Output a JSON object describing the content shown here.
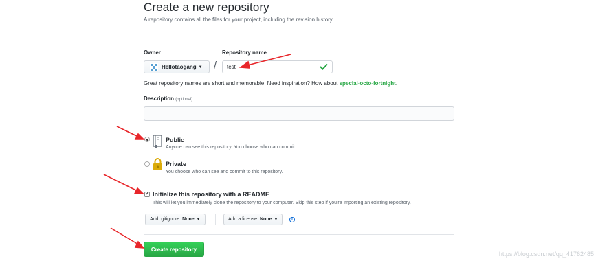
{
  "page": {
    "title": "Create a new repository",
    "subtitle": "A repository contains all the files for your project, including the revision history."
  },
  "owner": {
    "label": "Owner",
    "value": "Hellotaogang",
    "avatar_icon": "avatar-identicon",
    "avatar_color": "#57a0d3"
  },
  "separator": "/",
  "repo_name": {
    "label": "Repository name",
    "value": "test",
    "valid_icon": "check-icon",
    "valid_color": "#28a745"
  },
  "hint": {
    "text": "Great repository names are short and memorable. Need inspiration? How about",
    "suggestion": "special-octo-fortnight",
    "end": "."
  },
  "description": {
    "label": "Description",
    "optional": "(optional)",
    "value": ""
  },
  "visibility": {
    "public": {
      "title": "Public",
      "desc": "Anyone can see this repository. You choose who can commit.",
      "selected": true,
      "icon": "repo-book-icon"
    },
    "private": {
      "title": "Private",
      "desc": "You choose who can see and commit to this repository.",
      "selected": false,
      "icon": "lock-icon"
    }
  },
  "readme": {
    "title": "Initialize this repository with a README",
    "desc": "This will let you immediately clone the repository to your computer. Skip this step if you're importing an existing repository.",
    "checked": true,
    "check_mark": "✔"
  },
  "gitignore": {
    "label": "Add .gitignore:",
    "value": "None"
  },
  "license": {
    "label": "Add a license:",
    "value": "None"
  },
  "info_icon": "i",
  "create_button": "Create repository",
  "watermark": "https://blog.csdn.net/qq_41762485",
  "colors": {
    "accent_green": "#28a745",
    "arrow_red": "#e8262a",
    "link_blue": "#0366d6"
  }
}
